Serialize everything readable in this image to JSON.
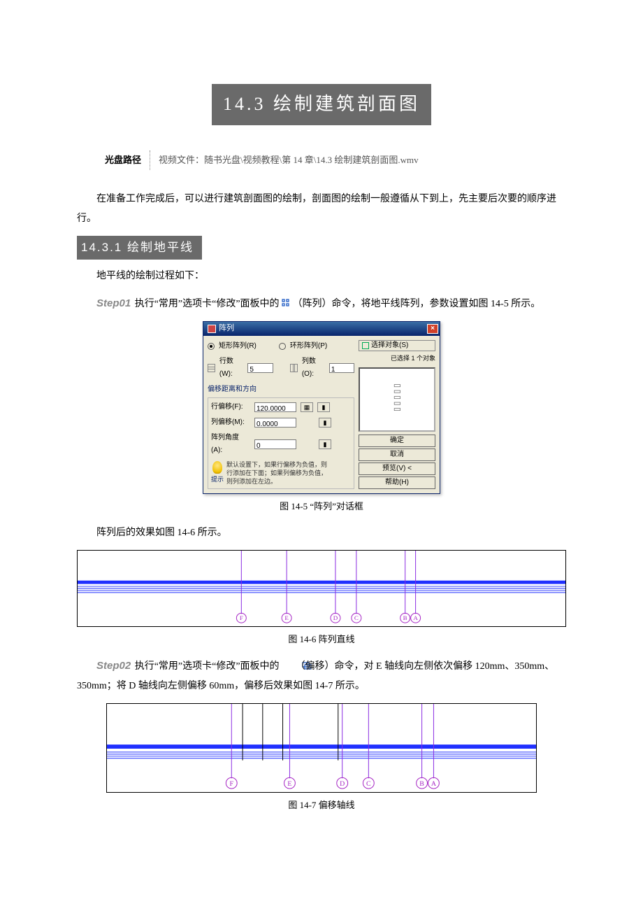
{
  "main_title": "14.3  绘制建筑剖面图",
  "path_label": "光盘路径",
  "path_value": "视频文件：随书光盘\\视频教程\\第 14 章\\14.3 绘制建筑剖面图.wmv",
  "intro_para": "在准备工作完成后，可以进行建筑剖面图的绘制，剖面图的绘制一般遵循从下到上，先主要后次要的顺序进行。",
  "sub_title": "14.3.1  绘制地平线",
  "sub_intro": "地平线的绘制过程如下：",
  "step01": {
    "label": "Step01",
    "before_icon": "执行“常用”选项卡“修改”面板中的",
    "after_icon": "（阵列）命令，将地平线阵列，参数设置如图 14-5 所示。"
  },
  "dialog": {
    "title": "阵列",
    "radio_rect": "矩形阵列(R)",
    "radio_polar": "环形阵列(P)",
    "pick_btn": "选择对象(S)",
    "selected_msg": "已选择 1 个对象",
    "rows_label": "行数(W):",
    "rows_value": "5",
    "cols_label": "列数(O):",
    "cols_value": "1",
    "group_title": "偏移距离和方向",
    "row_offset_label": "行偏移(F):",
    "row_offset_value": "120.0000",
    "col_offset_label": "列偏移(M):",
    "col_offset_value": "0.0000",
    "array_angle_label": "阵列角度(A):",
    "array_angle_value": "0",
    "tip_text": "默认设置下，如果行偏移为负值，则行添加在下面；如果列偏移为负值，则列添加在左边。",
    "tip_label": "提示",
    "btn_ok": "确定",
    "btn_cancel": "取消",
    "btn_preview": "预览(V) <",
    "btn_help": "帮助(H)"
  },
  "fig5_caption": "图 14-5  “阵列”对话框",
  "after_fig5": "阵列后的效果如图 14-6 所示。",
  "fig6": {
    "caption": "图 14-6  阵列直线",
    "axis_labels": [
      "F",
      "E",
      "D",
      "C",
      "B",
      "A"
    ]
  },
  "step02": {
    "label": "Step02",
    "before_icon": "执行“常用”选项卡“修改”面板中的",
    "after_icon": "（偏移）命令，对 E 轴线向左侧依次偏移 120mm、350mm、350mm；将 D 轴线向左侧偏移 60mm，偏移后效果如图 14-7 所示。"
  },
  "fig7": {
    "caption": "图 14-7  偏移轴线",
    "axis_labels": [
      "F",
      "E",
      "D",
      "C",
      "B",
      "A"
    ]
  }
}
